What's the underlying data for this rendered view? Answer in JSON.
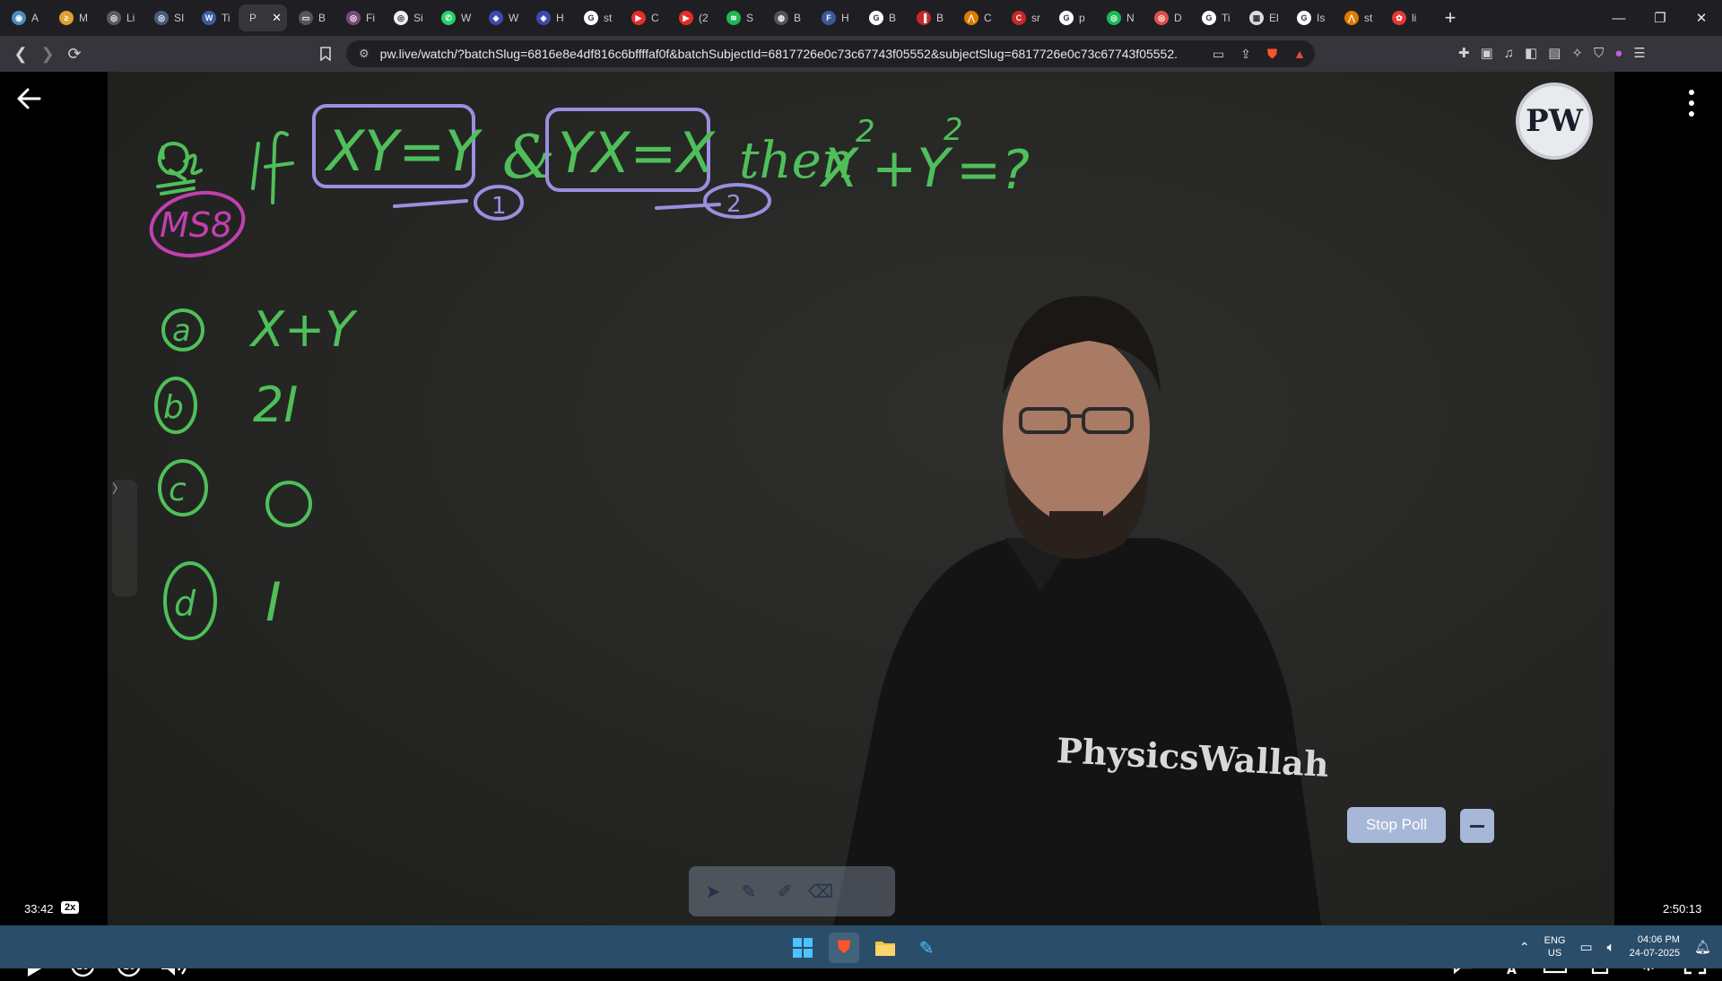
{
  "browser": {
    "tabs": [
      {
        "label": "A",
        "color": "#4a8fb8",
        "glyph": "◉"
      },
      {
        "label": "M",
        "color": "#e0a030",
        "glyph": "≥"
      },
      {
        "label": "Li",
        "color": "#5a5a60",
        "glyph": "◎"
      },
      {
        "label": "SI",
        "color": "#4a5a80",
        "glyph": "◎"
      },
      {
        "label": "Ti",
        "color": "#3a5fa0",
        "glyph": "W"
      },
      {
        "label": "P",
        "color": "#35353b",
        "glyph": "",
        "active": true
      },
      {
        "label": "B",
        "color": "#555",
        "glyph": "▭"
      },
      {
        "label": "Fi",
        "color": "#7a4a7a",
        "glyph": "◎"
      },
      {
        "label": "Si",
        "color": "#eee",
        "glyph": "◎"
      },
      {
        "label": "W",
        "color": "#25d366",
        "glyph": "✆"
      },
      {
        "label": "W",
        "color": "#3a4ab0",
        "glyph": "◈"
      },
      {
        "label": "H",
        "color": "#3a4ab0",
        "glyph": "◈"
      },
      {
        "label": "st",
        "color": "#fff",
        "glyph": "G"
      },
      {
        "label": "C",
        "color": "#e52d27",
        "glyph": "▶"
      },
      {
        "label": "(2",
        "color": "#e52d27",
        "glyph": "▶"
      },
      {
        "label": "S",
        "color": "#1db954",
        "glyph": "≋"
      },
      {
        "label": "B",
        "color": "#555",
        "glyph": "◍"
      },
      {
        "label": "H",
        "color": "#3b5998",
        "glyph": "F"
      },
      {
        "label": "B",
        "color": "#fff",
        "glyph": "G"
      },
      {
        "label": "B",
        "color": "#c62828",
        "glyph": "▐"
      },
      {
        "label": "C",
        "color": "#e07b00",
        "glyph": "⋀"
      },
      {
        "label": "sr",
        "color": "#c62828",
        "glyph": "C"
      },
      {
        "label": "p",
        "color": "#fff",
        "glyph": "G"
      },
      {
        "label": "N",
        "color": "#1db954",
        "glyph": "◎"
      },
      {
        "label": "D",
        "color": "#e05050",
        "glyph": "◎"
      },
      {
        "label": "Ti",
        "color": "#fff",
        "glyph": "G"
      },
      {
        "label": "El",
        "color": "#ddd",
        "glyph": "▦"
      },
      {
        "label": "Is",
        "color": "#fff",
        "glyph": "G"
      },
      {
        "label": "st",
        "color": "#e07b00",
        "glyph": "⋀"
      },
      {
        "label": "li",
        "color": "#e53935",
        "glyph": "✿"
      }
    ],
    "active_tab_label": "P",
    "new_tab_label": "+",
    "url": "pw.live/watch/?batchSlug=6816e8e4df816c6bffffaf0f&batchSubjectId=6817726e0c73c67743f05552&subjectSlug=6817726e0c73c67743f05552..."
  },
  "player": {
    "current_time": "33:42",
    "speed_badge": "2x",
    "duration": "2:50:13",
    "progress_fraction": 0.198,
    "stop_poll_label": "Stop Poll",
    "shirt_brand": "PhysicsWallah",
    "logo_text": "PW",
    "accent_color": "#5a7fff"
  },
  "board": {
    "question_prefix": "Qe",
    "question": "If XY = Y & YX = X then X² + Y² = ?",
    "tag": "MS8",
    "options": [
      {
        "key": "a",
        "text": "X+Y"
      },
      {
        "key": "b",
        "text": "2I"
      },
      {
        "key": "c",
        "text": "O"
      },
      {
        "key": "d",
        "text": "I"
      }
    ],
    "ink_color": "#4fbf5a",
    "highlight_color": "#9b8fe0",
    "tag_color": "#c040b0"
  },
  "taskbar": {
    "lang_line1": "ENG",
    "lang_line2": "US",
    "time": "04:06 PM",
    "date": "24-07-2025"
  }
}
